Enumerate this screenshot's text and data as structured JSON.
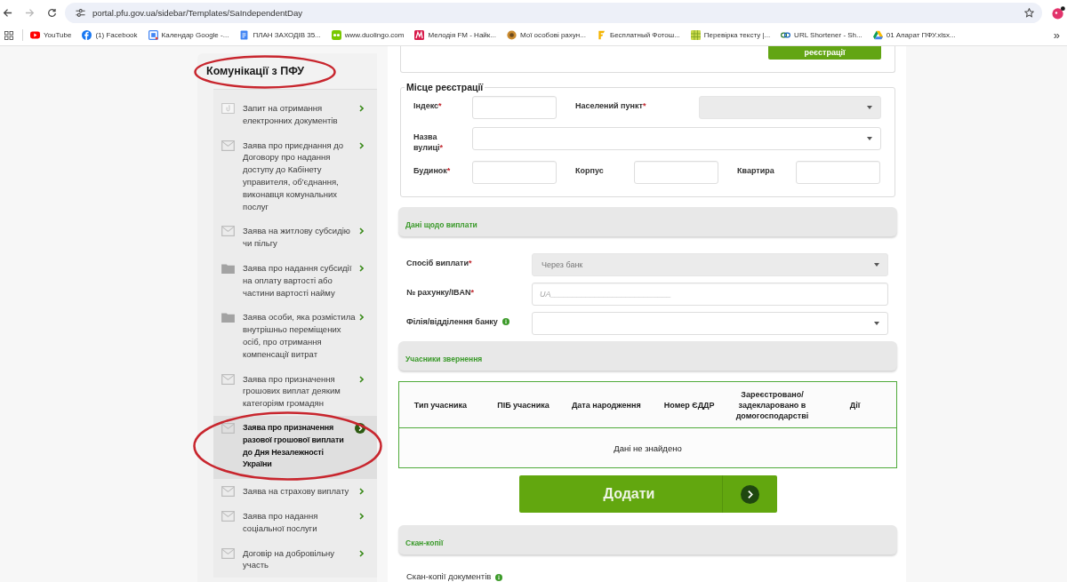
{
  "browser": {
    "forward_disabled": true,
    "url": "portal.pfu.gov.ua/sidebar/Templates/SaIndependentDay",
    "bookmarks": [
      "YouTube",
      "(1) Facebook",
      "Календар Google -...",
      "ПЛАН ЗАХОДІВ 35...",
      "www.duolingo.com",
      "Мелодія FM - Найк...",
      "Мої особові рахун...",
      "Бесплатный Фотош...",
      "Перевірка тексту |...",
      "URL Shortener - Sh...",
      "01 Апарат ПФУ.xlsx..."
    ],
    "more": "»"
  },
  "sidebar": {
    "title": "Комунікації з ПФУ",
    "circled": true,
    "items": [
      {
        "label": "Запит на отримання електронних документів",
        "selected": false,
        "circled": false
      },
      {
        "label": "Заява про приєднання до Договору про надання доступу до Кабінету управителя, об'єднання, виконавця комунальних послуг",
        "selected": false,
        "circled": false
      },
      {
        "label": "Заява на житлову субсидію чи пільгу",
        "selected": false,
        "circled": false
      },
      {
        "label": "Заява про надання субсидії на оплату вартості або частини вартості найму",
        "selected": false,
        "circled": false
      },
      {
        "label": "Заява особи, яка розмістила внутрішньо переміщених осіб, про отримання компенсації витрат",
        "selected": false,
        "circled": false
      },
      {
        "label": "Заява про призначення грошових виплат деяким категоріям громадян",
        "selected": false,
        "circled": false
      },
      {
        "label": "Заява про призначення разової грошової виплати до Дня Незалежності України",
        "selected": true,
        "circled": true
      },
      {
        "label": "Заява на страхову виплату",
        "selected": false,
        "circled": false
      },
      {
        "label": "Заява про надання соціальної послуги",
        "selected": false,
        "circled": false
      },
      {
        "label": "Договір на добровільну участь",
        "selected": false,
        "circled": false
      }
    ]
  },
  "top_panel": {
    "button": "реєстрації"
  },
  "registration": {
    "legend": "Місце реєстрації",
    "rows": [
      [
        {
          "label": "Індекс",
          "mark": "*",
          "kind": "input",
          "disabled": false
        },
        {
          "label": "Населений пункт",
          "mark": "*",
          "kind": "select",
          "disabled": true
        }
      ],
      [
        {
          "label": "Назва вулиці",
          "mark": "*",
          "kind": "select",
          "disabled": false
        }
      ],
      [
        {
          "label": "Будинок",
          "mark": "*",
          "kind": "input",
          "disabled": false
        },
        {
          "label": "Корпус",
          "kind": "input",
          "disabled": false
        },
        {
          "label": "Квартира",
          "kind": "input",
          "disabled": false
        }
      ]
    ]
  },
  "payment": {
    "title": "Дані щодо виплати",
    "fields": [
      {
        "label": "Спосіб виплати",
        "mark": "*",
        "kind": "select",
        "disabled": true,
        "info": false,
        "value": "Через банк"
      },
      {
        "label": "№ рахунку/IBAN",
        "mark": "*",
        "kind": "input",
        "disabled": false,
        "info": false,
        "placeholder": "UA___________________________"
      },
      {
        "label": "Філія/відділення банку",
        "kind": "select",
        "disabled": false,
        "info": true
      }
    ]
  },
  "participants": {
    "title": "Учасники звернення",
    "columns": [
      "Тип учасника",
      "ПІБ учасника",
      "Дата народження",
      "Номер ЄДДР",
      "Зареєстровано/ задекларовано в домогосподарстві",
      "Дії"
    ],
    "empty_message": "Дані не знайдено",
    "add_button": "Додати"
  },
  "scans": {
    "title": "Скан-копії",
    "label": "Скан-копії документів",
    "info": true
  }
}
